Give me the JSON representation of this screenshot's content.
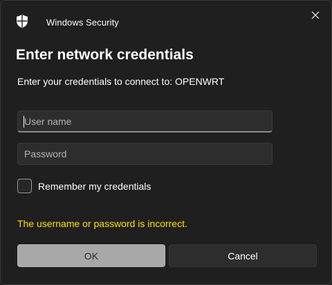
{
  "window": {
    "title": "Windows Security",
    "icon": "shield-icon",
    "close_icon": "close-icon"
  },
  "heading": "Enter network credentials",
  "subtext": "Enter your credentials to connect to: OPENWRT",
  "username": {
    "value": "",
    "placeholder": "User name"
  },
  "password": {
    "value": "",
    "placeholder": "Password"
  },
  "remember": {
    "label": "Remember my credentials",
    "checked": false
  },
  "error": "The username or password is incorrect.",
  "buttons": {
    "ok": "OK",
    "cancel": "Cancel"
  },
  "colors": {
    "background": "#1f1f1f",
    "error": "#fce100",
    "ok_button": "#a8a8a8",
    "cancel_button": "#2d2d2d"
  }
}
